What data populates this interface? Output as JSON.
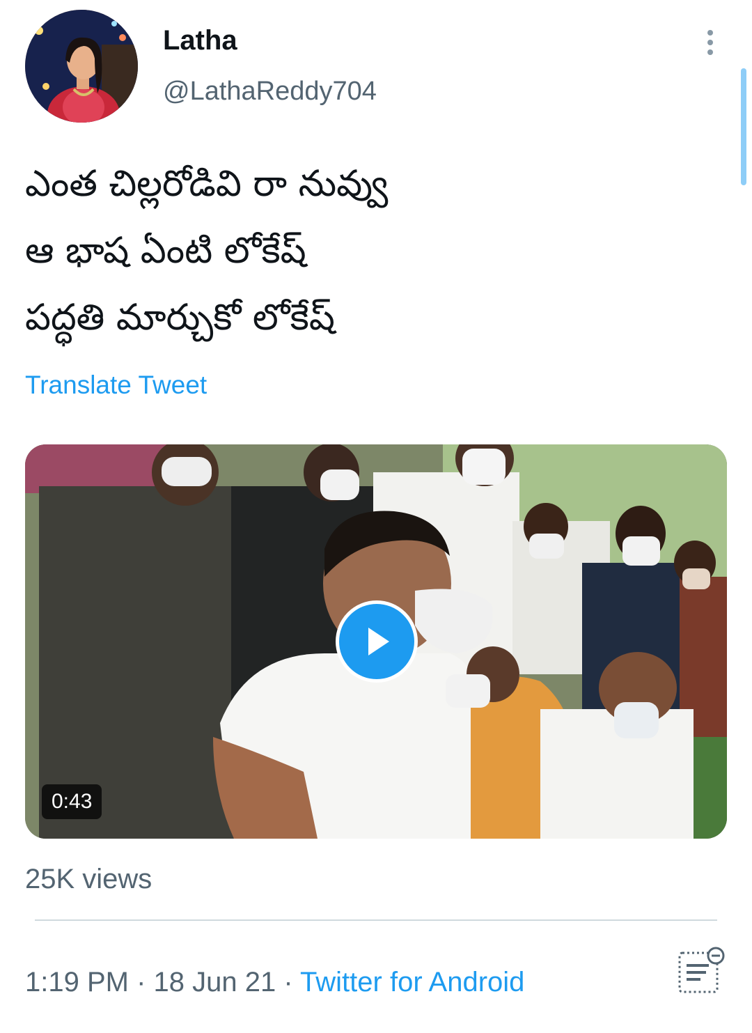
{
  "tweet": {
    "display_name": "Latha",
    "handle": "@LathaReddy704",
    "text_lines": [
      "ఎంత చిల్లరోడివి రా నువ్వు",
      "ఆ భాష ఏంటి లోకేష్",
      "పద్ధతి మార్చుకో లోకేష్"
    ],
    "translate_label": "Translate Tweet"
  },
  "media": {
    "type": "video",
    "duration": "0:43",
    "play_icon": "play-icon"
  },
  "stats": {
    "views": "25K views"
  },
  "meta": {
    "time": "1:19 PM",
    "separator": " · ",
    "date": "18 Jun 21",
    "source": "Twitter for Android"
  },
  "icons": {
    "more": "more-vertical-icon",
    "analytics": "view-analytics-icon"
  },
  "colors": {
    "accent": "#1d9bf0",
    "secondary_text": "#536471",
    "primary_text": "#0f1419"
  }
}
